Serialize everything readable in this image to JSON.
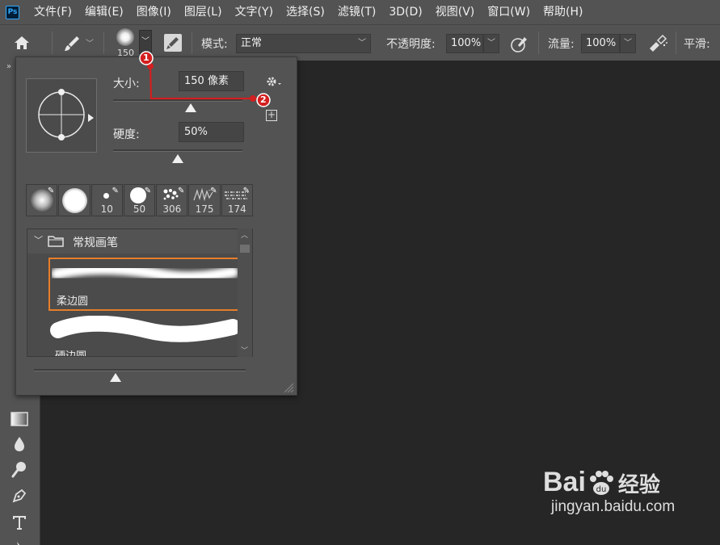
{
  "menubar": {
    "app_badge": "Ps",
    "items": [
      "文件(F)",
      "编辑(E)",
      "图像(I)",
      "图层(L)",
      "文字(Y)",
      "选择(S)",
      "滤镜(T)",
      "3D(D)",
      "视图(V)",
      "窗口(W)",
      "帮助(H)"
    ]
  },
  "options": {
    "brush_size_num": "150",
    "mode_label": "模式:",
    "mode_value": "正常",
    "opacity_label": "不透明度:",
    "opacity_value": "100%",
    "flow_label": "流量:",
    "flow_value": "100%",
    "smoothing_label": "平滑:"
  },
  "panel": {
    "size_label": "大小:",
    "size_value": "150 像素",
    "hardness_label": "硬度:",
    "hardness_value": "50%",
    "size_slider_fraction": 0.6,
    "hardness_slider_fraction": 0.5,
    "presets": [
      "",
      "",
      "10",
      "50",
      "306",
      "175",
      "174"
    ],
    "group_name": "常规画笔",
    "brushes": [
      "柔边圆",
      "硬边圆"
    ]
  },
  "annotations": [
    "1",
    "2"
  ],
  "watermark": {
    "brand_left": "Bai",
    "brand_right": "经验",
    "url": "jingyan.baidu.com"
  }
}
